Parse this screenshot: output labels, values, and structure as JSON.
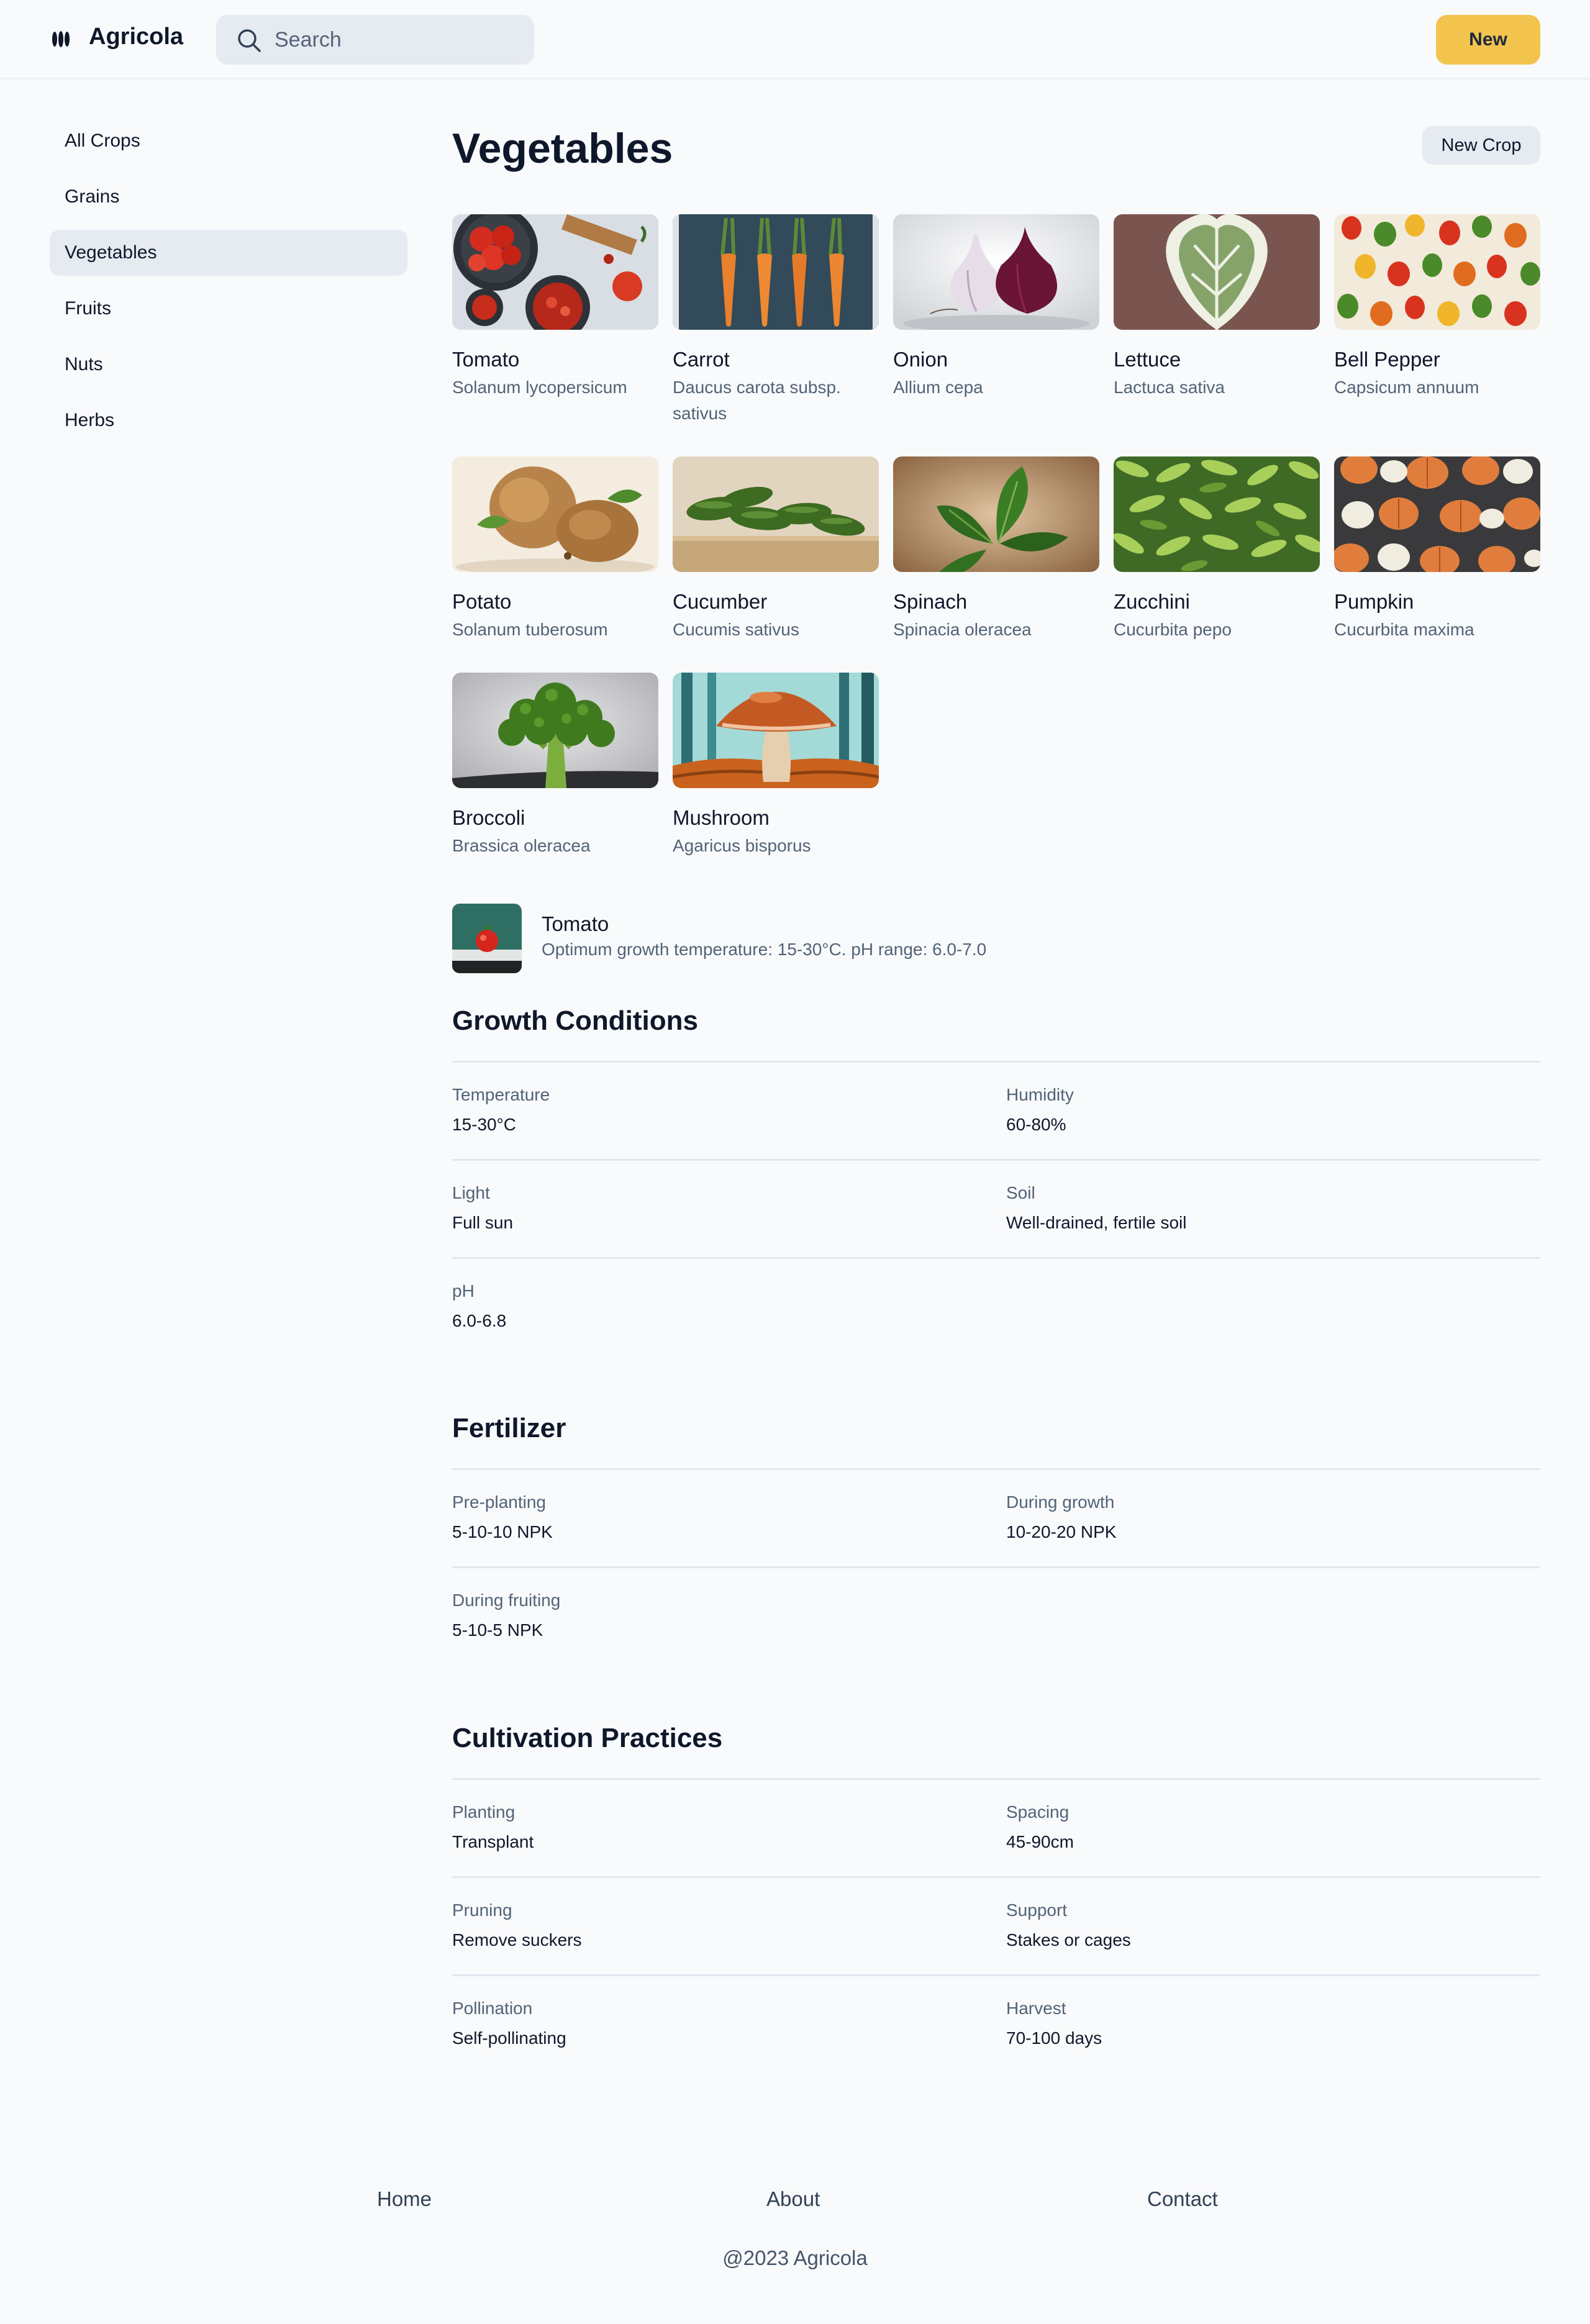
{
  "header": {
    "brand": "Agricola",
    "search_placeholder": "Search",
    "new_label": "New",
    "logo_icon": "wheat-logo-icon"
  },
  "sidebar": {
    "items": [
      {
        "label": "All Crops",
        "active": false
      },
      {
        "label": "Grains",
        "active": false
      },
      {
        "label": "Vegetables",
        "active": true
      },
      {
        "label": "Fruits",
        "active": false
      },
      {
        "label": "Nuts",
        "active": false
      },
      {
        "label": "Herbs",
        "active": false
      }
    ]
  },
  "main": {
    "title": "Vegetables",
    "new_crop_label": "New Crop",
    "crops": [
      {
        "name": "Tomato",
        "scientific": "Solanum lycopersicum"
      },
      {
        "name": "Carrot",
        "scientific": "Daucus carota subsp. sativus"
      },
      {
        "name": "Onion",
        "scientific": "Allium cepa"
      },
      {
        "name": "Lettuce",
        "scientific": "Lactuca sativa"
      },
      {
        "name": "Bell Pepper",
        "scientific": "Capsicum annuum"
      },
      {
        "name": "Potato",
        "scientific": "Solanum tuberosum"
      },
      {
        "name": "Cucumber",
        "scientific": "Cucumis sativus"
      },
      {
        "name": "Spinach",
        "scientific": "Spinacia oleracea"
      },
      {
        "name": "Zucchini",
        "scientific": "Cucurbita pepo"
      },
      {
        "name": "Pumpkin",
        "scientific": "Cucurbita maxima"
      },
      {
        "name": "Broccoli",
        "scientific": "Brassica oleracea"
      },
      {
        "name": "Mushroom",
        "scientific": "Agaricus bisporus"
      }
    ],
    "featured": {
      "name": "Tomato",
      "description": "Optimum growth temperature: 15-30°C. pH range: 6.0-7.0"
    },
    "growth": {
      "title": "Growth Conditions",
      "rows": [
        [
          {
            "label": "Temperature",
            "value": "15-30°C"
          },
          {
            "label": "Humidity",
            "value": "60-80%"
          }
        ],
        [
          {
            "label": "Light",
            "value": "Full sun"
          },
          {
            "label": "Soil",
            "value": "Well-drained, fertile soil"
          }
        ],
        [
          {
            "label": "pH",
            "value": "6.0-6.8"
          }
        ]
      ]
    },
    "fertilizer": {
      "title": "Fertilizer",
      "rows": [
        [
          {
            "label": "Pre-planting",
            "value": "5-10-10 NPK"
          },
          {
            "label": "During growth",
            "value": "10-20-20 NPK"
          }
        ],
        [
          {
            "label": "During fruiting",
            "value": "5-10-5 NPK"
          }
        ]
      ]
    },
    "cultivation": {
      "title": "Cultivation Practices",
      "rows": [
        [
          {
            "label": "Planting",
            "value": "Transplant"
          },
          {
            "label": "Spacing",
            "value": "45-90cm"
          }
        ],
        [
          {
            "label": "Pruning",
            "value": "Remove suckers"
          },
          {
            "label": "Support",
            "value": "Stakes or cages"
          }
        ],
        [
          {
            "label": "Pollination",
            "value": "Self-pollinating"
          },
          {
            "label": "Harvest",
            "value": "70-100 days"
          }
        ]
      ]
    }
  },
  "footer": {
    "links": [
      "Home",
      "About",
      "Contact"
    ],
    "copyright": "@2023 Agricola"
  },
  "colors": {
    "accent": "#f2c44d",
    "muted_text": "#536376",
    "active_bg": "#e6ebf1"
  }
}
